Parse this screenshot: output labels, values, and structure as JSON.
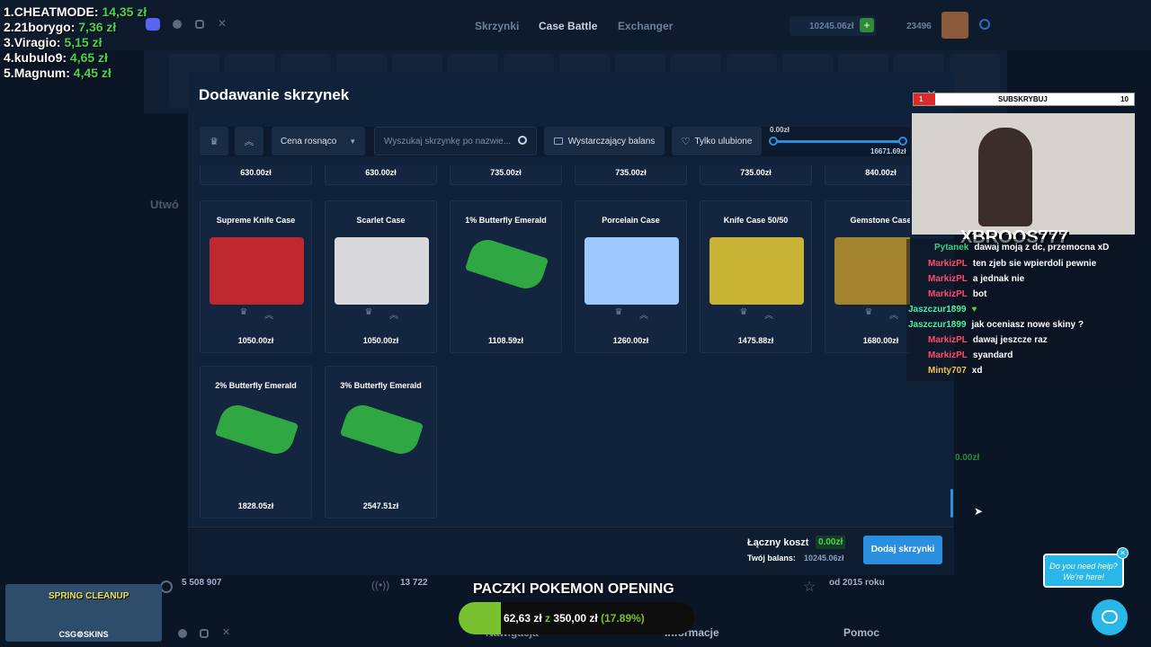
{
  "leaderboard": [
    {
      "rank": "1.",
      "name": "CHEATMODE:",
      "amount": "14,35 zł"
    },
    {
      "rank": "2.",
      "name": "21borygo:",
      "amount": "7,36 zł"
    },
    {
      "rank": "3.",
      "name": "Viragio:",
      "amount": "5,15 zł"
    },
    {
      "rank": "4.",
      "name": "kubulo9:",
      "amount": "4,65 zł"
    },
    {
      "rank": "5.",
      "name": "Magnum:",
      "amount": "4,45 zł"
    }
  ],
  "header": {
    "nav": [
      "Skrzynki",
      "Case Battle",
      "Exchanger"
    ],
    "balance": "10245.06zł",
    "points": "23496"
  },
  "modal": {
    "title": "Dodawanie skrzynek",
    "sort_label": "Cena rosnąco",
    "search_placeholder": "Wyszukaj skrzynkę po nazwie...",
    "balance_filter": "Wystarczający balans",
    "favorites_filter": "Tylko ulubione",
    "range_min": "0.00zł",
    "range_max": "16671.69zł",
    "top_prices": [
      "630.00zł",
      "630.00zł",
      "735.00zł",
      "735.00zł",
      "735.00zł",
      "840.00zł"
    ],
    "cases": [
      {
        "name": "Supreme Knife Case",
        "price": "1050.00zł",
        "color": "#c0282f",
        "icons": true
      },
      {
        "name": "Scarlet Case",
        "price": "1050.00zł",
        "color": "#d9d9dc",
        "icons": true
      },
      {
        "name": "1% Butterfly Emerald",
        "price": "1108.59zł",
        "color": "#2fa844",
        "icons": false
      },
      {
        "name": "Porcelain Case",
        "price": "1260.00zł",
        "color": "#9cc8ff",
        "icons": true
      },
      {
        "name": "Knife Case 50/50",
        "price": "1475.88zł",
        "color": "#c9b335",
        "icons": true
      },
      {
        "name": "Gemstone Case",
        "price": "1680.00zł",
        "color": "#a2842f",
        "icons": true
      },
      {
        "name": "2% Butterfly Emerald",
        "price": "1828.05zł",
        "color": "#2fa844",
        "icons": false
      },
      {
        "name": "3% Butterfly Emerald",
        "price": "2547.51zł",
        "color": "#2fa844",
        "icons": false
      }
    ],
    "total_label": "Łączny koszt",
    "total_value": "0.00zł",
    "your_balance_label": "Twój balans:",
    "your_balance_value": "10245.06zł",
    "add_button": "Dodaj skrzynki"
  },
  "stream": {
    "sub_left": "1",
    "sub_label": "SUBSKRYBUJ",
    "sub_right": "10",
    "streamer": "XBROOS777"
  },
  "chat": [
    {
      "user": "Pytanek",
      "msg": "dawaj moją z dc, przemocna xD",
      "color": "#36d27a"
    },
    {
      "user": "MarkizPL",
      "msg": "ten zjeb sie wpierdoli pewnie",
      "color": "#ff4c6a"
    },
    {
      "user": "MarkizPL",
      "msg": "a jednak nie",
      "color": "#ff4c6a"
    },
    {
      "user": "MarkizPL",
      "msg": "bot",
      "color": "#ff4c6a"
    },
    {
      "user": "Jaszczur1899",
      "msg": "",
      "color": "#4cf0a0"
    },
    {
      "user": "Jaszczur1899",
      "msg": "jak oceniasz nowe skiny ?",
      "color": "#4cf0a0"
    },
    {
      "user": "MarkizPL",
      "msg": "dawaj jeszcze raz",
      "color": "#ff4c6a"
    },
    {
      "user": "MarkizPL",
      "msg": "syandard",
      "color": "#ff4c6a"
    },
    {
      "user": "Minty707",
      "msg": "xd",
      "color": "#f0c24c"
    }
  ],
  "bottom": {
    "stat1": "5 508 907",
    "stat2": "13 722",
    "stat3": "od 2015 roku",
    "footer_nav": [
      "Nawigacja",
      "Informacje",
      "Pomoc"
    ],
    "value_right": "0.00zł",
    "promo_title": "PACZKI POKEMON OPENING",
    "progress_text": "62,63 zł",
    "progress_of": "z",
    "progress_goal": "350,00 zł",
    "progress_percent": "(17.89%)",
    "progress_fraction": 0.1789,
    "spring_label": "SPRING CLEANUP",
    "brand": "CSG⚙SKINS"
  },
  "help": {
    "line1": "Do you need help?",
    "line2": "We're here!"
  }
}
